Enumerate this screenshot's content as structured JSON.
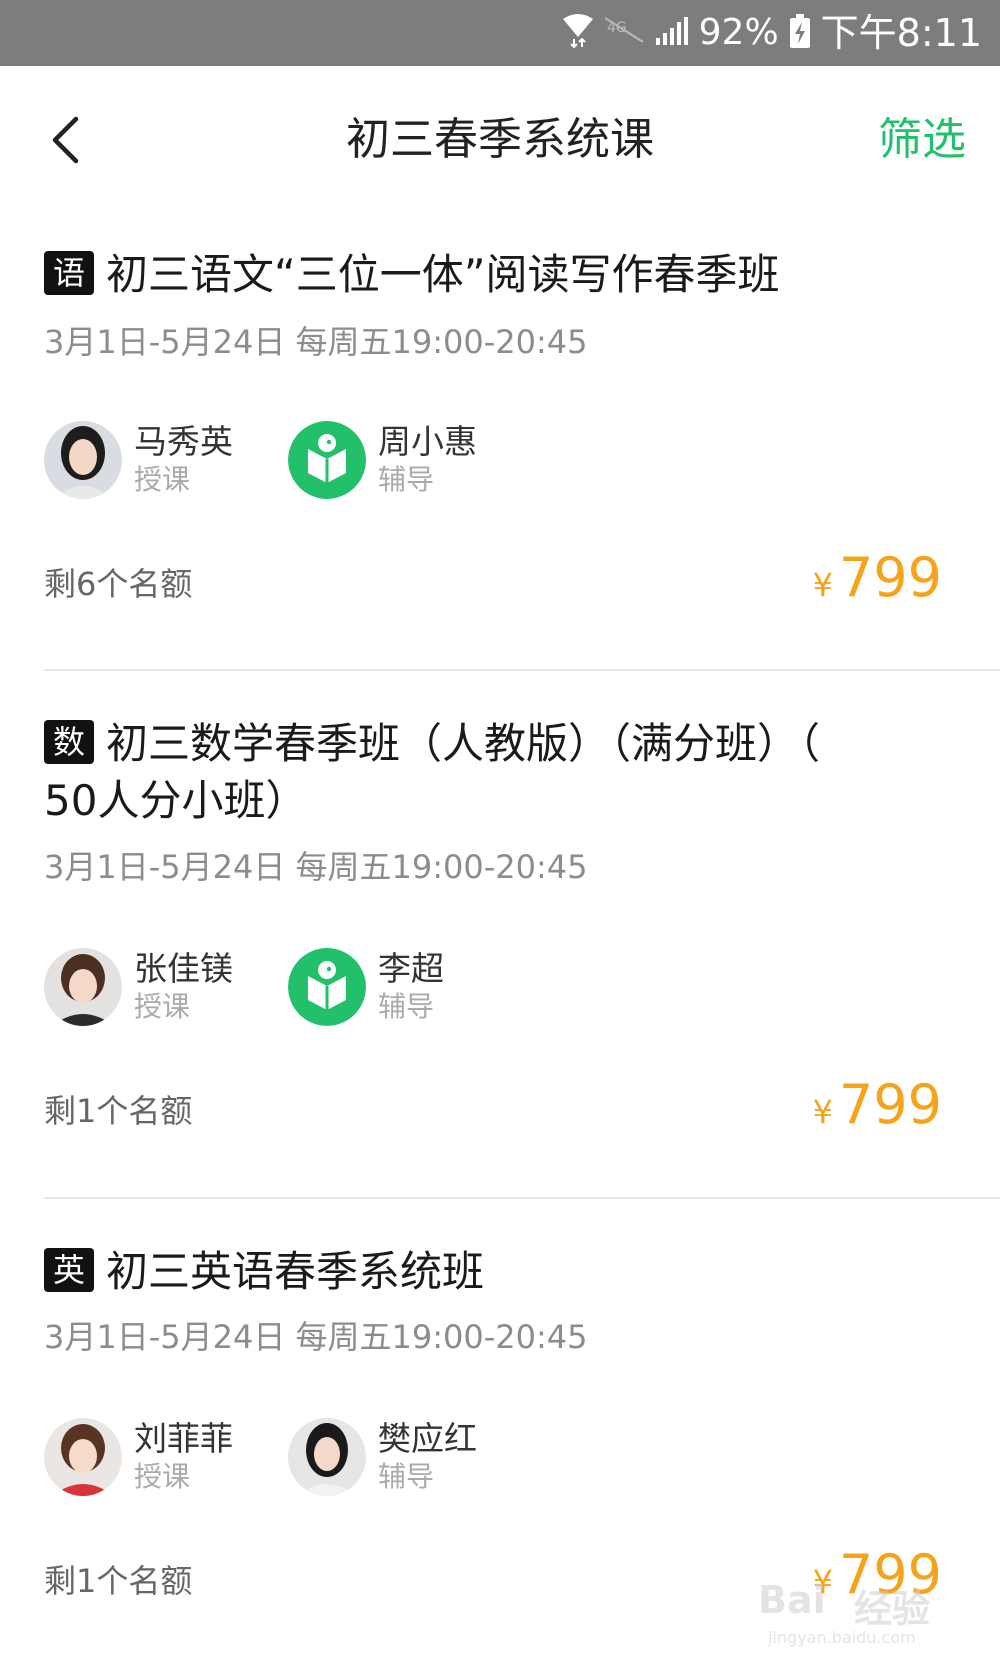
{
  "status_bar": {
    "battery_percent": "92%",
    "time": "下午8:11"
  },
  "header": {
    "title": "初三春季系统课",
    "filter_label": "筛选"
  },
  "courses": [
    {
      "subject_badge": "语",
      "title": "初三语文“三位一体”阅读写作春季班",
      "date": "3月1日-5月24日 每周五19:00-20:45",
      "teachers": [
        {
          "name": "马秀英",
          "role": "授课",
          "avatar": "photo-avatar"
        },
        {
          "name": "周小惠",
          "role": "辅导",
          "avatar": "app-logo-avatar"
        }
      ],
      "quota": "剩6个名额",
      "currency": "¥",
      "price": "799"
    },
    {
      "subject_badge": "数",
      "title": "初三数学春季班（人教版）（满分班）（",
      "title_line2": "50人分小班）",
      "date": "3月1日-5月24日 每周五19:00-20:45",
      "teachers": [
        {
          "name": "张佳镁",
          "role": "授课",
          "avatar": "photo-avatar"
        },
        {
          "name": "李超",
          "role": "辅导",
          "avatar": "app-logo-avatar"
        }
      ],
      "quota": "剩1个名额",
      "currency": "¥",
      "price": "799"
    },
    {
      "subject_badge": "英",
      "title": "初三英语春季系统班",
      "date": "3月1日-5月24日 每周五19:00-20:45",
      "teachers": [
        {
          "name": "刘菲菲",
          "role": "授课",
          "avatar": "photo-avatar"
        },
        {
          "name": "樊应红",
          "role": "辅导",
          "avatar": "photo-avatar"
        }
      ],
      "quota": "剩1个名额",
      "currency": "¥",
      "price": "799"
    }
  ],
  "watermark": {
    "brand": "Bai",
    "brand2": "经验",
    "url": "jingyan.baidu.com"
  },
  "colors": {
    "accent_green": "#22c06a",
    "price_orange": "#f5a31a",
    "status_bar_bg": "#7d7d7d"
  }
}
